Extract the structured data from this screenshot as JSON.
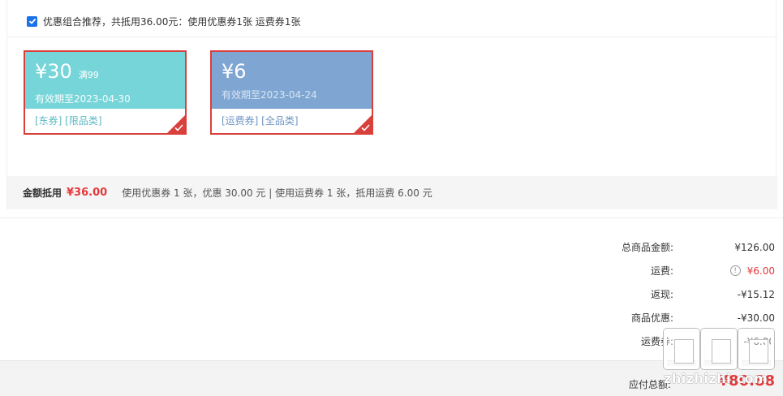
{
  "combo": {
    "checked": true,
    "text": "优惠组合推荐，共抵用36.00元：使用优惠券1张 运费券1张"
  },
  "coupons": [
    {
      "amount": "¥30",
      "condition": "满99",
      "valid_until": "有效期至2023-04-30",
      "tags": "[东券]  [限品类]",
      "selected": true
    },
    {
      "amount": "¥6",
      "condition": "",
      "valid_until": "有效期至2023-04-24",
      "tags": "[运费券]  [全品类]",
      "selected": true
    }
  ],
  "summary": {
    "label": "金额抵用",
    "amount": "¥36.00",
    "detail": "使用优惠券 1 张，优惠 30.00 元  | 使用运费券 1 张，抵用运费 6.00 元"
  },
  "totals": [
    {
      "label": "总商品金额:",
      "value": "¥126.00",
      "style": "normal"
    },
    {
      "label": "运费:",
      "value": "¥6.00",
      "style": "orange",
      "info": "!"
    },
    {
      "label": "返现:",
      "value": "-¥15.12",
      "style": "normal"
    },
    {
      "label": "商品优惠:",
      "value": "-¥30.00",
      "style": "normal"
    },
    {
      "label": "运费券:",
      "value": "-¥6.00",
      "style": "normal"
    }
  ],
  "payable": {
    "label": "应付总额:",
    "value": "¥80.88"
  },
  "watermark": {
    "text": "zhizhizhi.com"
  },
  "colors": {
    "accent_red": "#e4393c",
    "coupon_teal": "#76d5d8",
    "coupon_blue": "#7fa6d2",
    "checkbox_blue": "#1a73e8"
  }
}
